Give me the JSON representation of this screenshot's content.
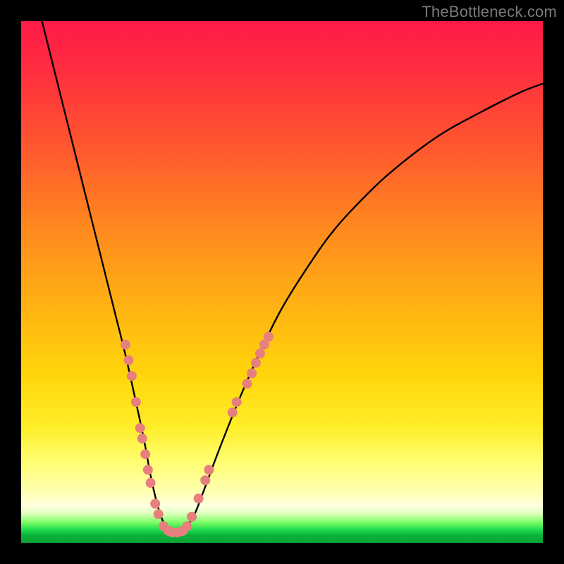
{
  "watermark": "TheBottleneck.com",
  "chart_data": {
    "type": "line",
    "title": "",
    "xlabel": "",
    "ylabel": "",
    "xlim": [
      0,
      100
    ],
    "ylim": [
      0,
      100
    ],
    "grid": false,
    "legend": false,
    "series": [
      {
        "name": "bottleneck-curve",
        "color": "#000000",
        "x": [
          4,
          6,
          8,
          10,
          12,
          14,
          16,
          18,
          20,
          22,
          23.5,
          25,
          26.5,
          28,
          29,
          30,
          31,
          33,
          35,
          38,
          42,
          46,
          50,
          55,
          60,
          66,
          72,
          80,
          88,
          96,
          100
        ],
        "y": [
          100,
          92,
          84,
          76,
          68,
          60,
          52,
          44,
          36,
          27,
          20,
          12,
          6,
          2.5,
          2,
          2,
          2.5,
          5,
          10,
          18,
          28,
          37,
          45,
          53,
          60,
          66.5,
          72,
          78,
          82.5,
          86.5,
          88
        ]
      }
    ],
    "markers": [
      {
        "name": "dots-left",
        "color": "#e77f7f",
        "radius": 7,
        "points": [
          [
            20.0,
            38
          ],
          [
            20.6,
            35
          ],
          [
            21.2,
            32
          ],
          [
            22.0,
            27
          ],
          [
            22.8,
            22
          ],
          [
            23.2,
            20
          ],
          [
            23.8,
            17
          ],
          [
            24.3,
            14
          ],
          [
            24.8,
            11.5
          ],
          [
            25.7,
            7.5
          ],
          [
            26.3,
            5.5
          ],
          [
            27.3,
            3.2
          ],
          [
            28.2,
            2.3
          ],
          [
            29.0,
            2.0
          ],
          [
            30.0,
            2.0
          ]
        ]
      },
      {
        "name": "dots-right",
        "color": "#e77f7f",
        "radius": 7,
        "points": [
          [
            31.0,
            2.3
          ],
          [
            31.8,
            3.2
          ],
          [
            32.7,
            5.0
          ],
          [
            34.0,
            8.5
          ],
          [
            35.3,
            12.0
          ],
          [
            36.0,
            14.0
          ],
          [
            40.5,
            25.0
          ],
          [
            41.3,
            27.0
          ],
          [
            43.3,
            30.5
          ],
          [
            44.2,
            32.5
          ],
          [
            45.0,
            34.5
          ],
          [
            45.8,
            36.3
          ],
          [
            46.6,
            38.0
          ],
          [
            47.4,
            39.5
          ]
        ]
      }
    ]
  }
}
